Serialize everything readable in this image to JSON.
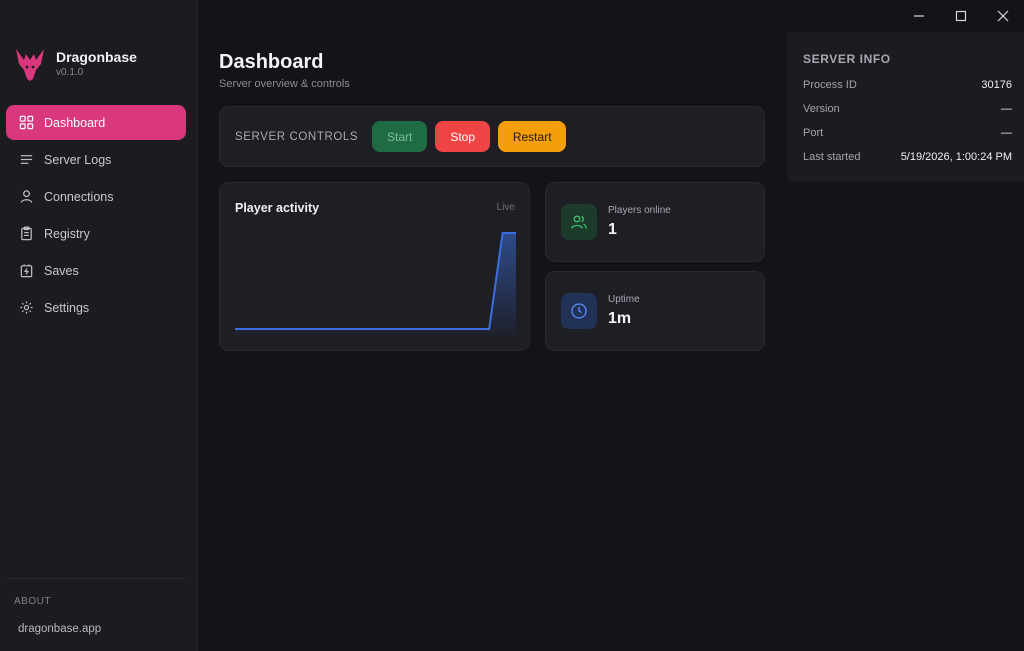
{
  "window": {
    "minimize_icon": "minimize-icon",
    "maximize_icon": "maximize-icon",
    "close_icon": "close-icon"
  },
  "brand": {
    "name": "Dragonbase",
    "version": "v0.1.0",
    "logo_color": "#d9387f"
  },
  "sidebar": {
    "items": [
      {
        "label": "Dashboard",
        "icon": "grid-icon",
        "active": true
      },
      {
        "label": "Server Logs",
        "icon": "lines-icon",
        "active": false
      },
      {
        "label": "Connections",
        "icon": "user-icon",
        "active": false
      },
      {
        "label": "Registry",
        "icon": "clipboard-icon",
        "active": false
      },
      {
        "label": "Saves",
        "icon": "battery-icon",
        "active": false
      },
      {
        "label": "Settings",
        "icon": "gear-icon",
        "active": false
      }
    ],
    "about_label": "ABOUT",
    "about_link": "dragonbase.app"
  },
  "main": {
    "title": "Dashboard",
    "subtitle": "Server overview & controls",
    "controls": {
      "label": "SERVER CONTROLS",
      "start": "Start",
      "stop": "Stop",
      "restart": "Restart"
    },
    "activity": {
      "title": "Player activity",
      "badge": "Live"
    },
    "stats": {
      "players_label": "Players online",
      "players_value": "1",
      "uptime_label": "Uptime",
      "uptime_value": "1m"
    }
  },
  "chart_data": {
    "type": "area",
    "title": "Player activity",
    "x": [
      0,
      1,
      2,
      3,
      4,
      5,
      6,
      7,
      8,
      9,
      10,
      11,
      12,
      13,
      14,
      15,
      16,
      17,
      18,
      19,
      20,
      21
    ],
    "values": [
      0,
      0,
      0,
      0,
      0,
      0,
      0,
      0,
      0,
      0,
      0,
      0,
      0,
      0,
      0,
      0,
      0,
      0,
      0,
      0,
      1,
      1
    ],
    "ylim": [
      0,
      1
    ],
    "grid": false,
    "color": "#3b6fe0"
  },
  "server_info": {
    "title": "SERVER INFO",
    "rows": [
      {
        "key": "Process ID",
        "value": "30176"
      },
      {
        "key": "Version",
        "value": "—"
      },
      {
        "key": "Port",
        "value": "—"
      },
      {
        "key": "Last started",
        "value": "5/19/2026, 1:00:24 PM"
      }
    ]
  },
  "colors": {
    "accent": "#d9387f",
    "start": "#1f6b43",
    "stop": "#ef4444",
    "restart": "#f59e0b"
  }
}
